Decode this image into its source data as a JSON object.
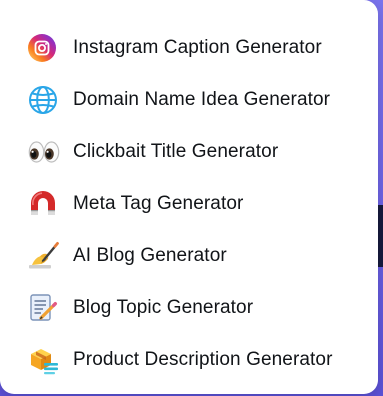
{
  "menu": {
    "items": [
      {
        "label": "Instagram Caption Generator",
        "icon": "instagram-icon"
      },
      {
        "label": "Domain Name Idea Generator",
        "icon": "globe-icon"
      },
      {
        "label": "Clickbait Title Generator",
        "icon": "eyes-icon"
      },
      {
        "label": "Meta Tag Generator",
        "icon": "magnet-icon"
      },
      {
        "label": "AI Blog Generator",
        "icon": "writing-hand-icon"
      },
      {
        "label": "Blog Topic Generator",
        "icon": "memo-icon"
      },
      {
        "label": "Product Description Generator",
        "icon": "package-icon"
      }
    ]
  },
  "colors": {
    "background_gradient_top": "#7b74ee",
    "background_gradient_bottom": "#5c52d8",
    "card": "#ffffff",
    "text": "#111418",
    "dark_patch": "#161a3e"
  }
}
